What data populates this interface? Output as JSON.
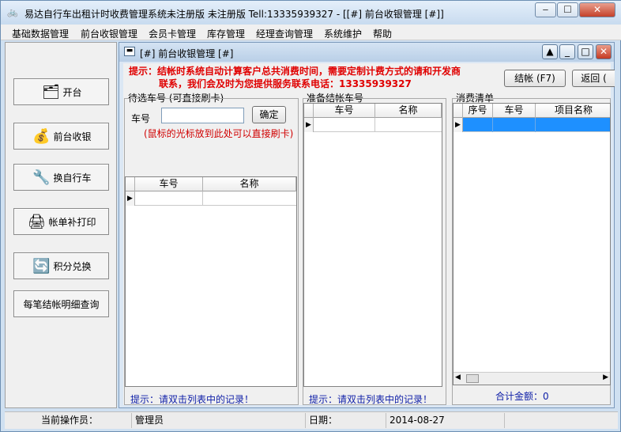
{
  "window": {
    "title": "易达自行车出租计时收费管理系统未注册版 未注册版  Tell:13335939327 - [[#] 前台收银管理 [#]]",
    "min": "‒",
    "max": "☐",
    "close": "✕"
  },
  "menu": [
    "基础数据管理",
    "前台收银管理",
    "会员卡管理",
    "库存管理",
    "经理查询管理",
    "系统维护",
    "帮助"
  ],
  "left_buttons": [
    {
      "label": "开台",
      "icon": "folder-icon",
      "glyph": "🗂"
    },
    {
      "label": "前台收银",
      "icon": "money-bag-icon",
      "glyph": "💰"
    },
    {
      "label": "换自行车",
      "icon": "tools-icon",
      "glyph": "🔧"
    },
    {
      "label": "帐单补打印",
      "icon": "printer-icon",
      "glyph": "🖨"
    },
    {
      "label": "积分兑换",
      "icon": "refresh-icon",
      "glyph": "🔄"
    },
    {
      "label": "每笔结帐明细查询",
      "icon": "",
      "glyph": ""
    }
  ],
  "inner": {
    "title": "[#] 前台收银管理 [#]",
    "min": "_",
    "max": "□",
    "close": "✕",
    "restore": "▲"
  },
  "tip_line1": "提示：结帐时系统自动计算客户总共消费时间，需要定制计费方式的请和开发商",
  "tip_line2": "联系，我们会及时为您提供服务联系电话：13335939327",
  "checkout_button": "结帐 (F7)",
  "back_button": "返回 (",
  "section1": {
    "label": "待选车号 (可直接刷卡)",
    "car_label": "车号",
    "car_value": "",
    "confirm": "确定",
    "note": "(鼠标的光标放到此处可以直接刷卡)",
    "columns": [
      "车号",
      "名称"
    ],
    "hint": "提示：请双击列表中的记录！"
  },
  "section2": {
    "label": "准备结帐车号",
    "columns": [
      "车号",
      "名称"
    ],
    "hint": "提示：请双击列表中的记录！"
  },
  "section3": {
    "label": "消费清单",
    "columns": [
      "序号",
      "车号",
      "项目名称"
    ],
    "total_label": "合计金额：0"
  },
  "status": {
    "operator_label": "当前操作员：",
    "operator_value": "管理员",
    "date_label": "日期：",
    "date_value": "2014-08-27"
  },
  "colors": {
    "tip": "#e00000",
    "hint": "#1020a8",
    "selected_row": "#1e90ff"
  }
}
